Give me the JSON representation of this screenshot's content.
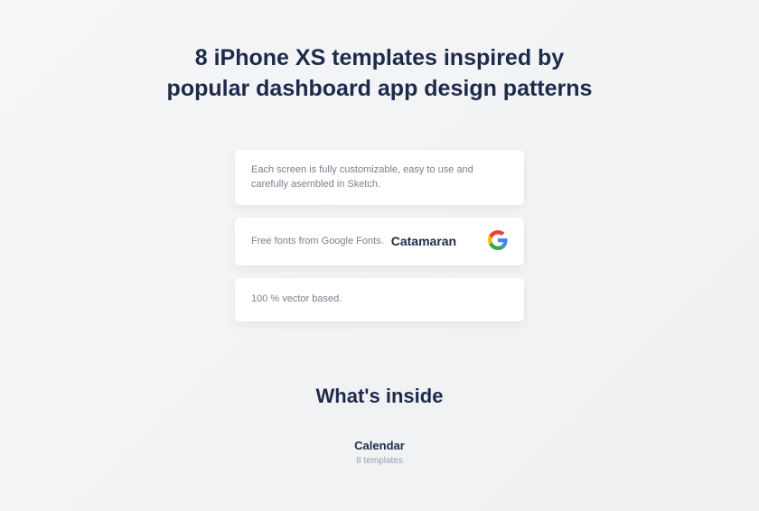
{
  "title_line1": "8 iPhone XS templates inspired by",
  "title_line2": "popular dashboard app design patterns",
  "cards": {
    "c1": "Each screen is fully customizable, easy to use and carefully asembled in Sketch.",
    "c2_text": "Free fonts from Google Fonts.",
    "c2_font": "Catamaran",
    "c3": "100 % vector based."
  },
  "subheading": "What's inside",
  "section": {
    "title": "Calendar",
    "sub": "8 templates"
  }
}
